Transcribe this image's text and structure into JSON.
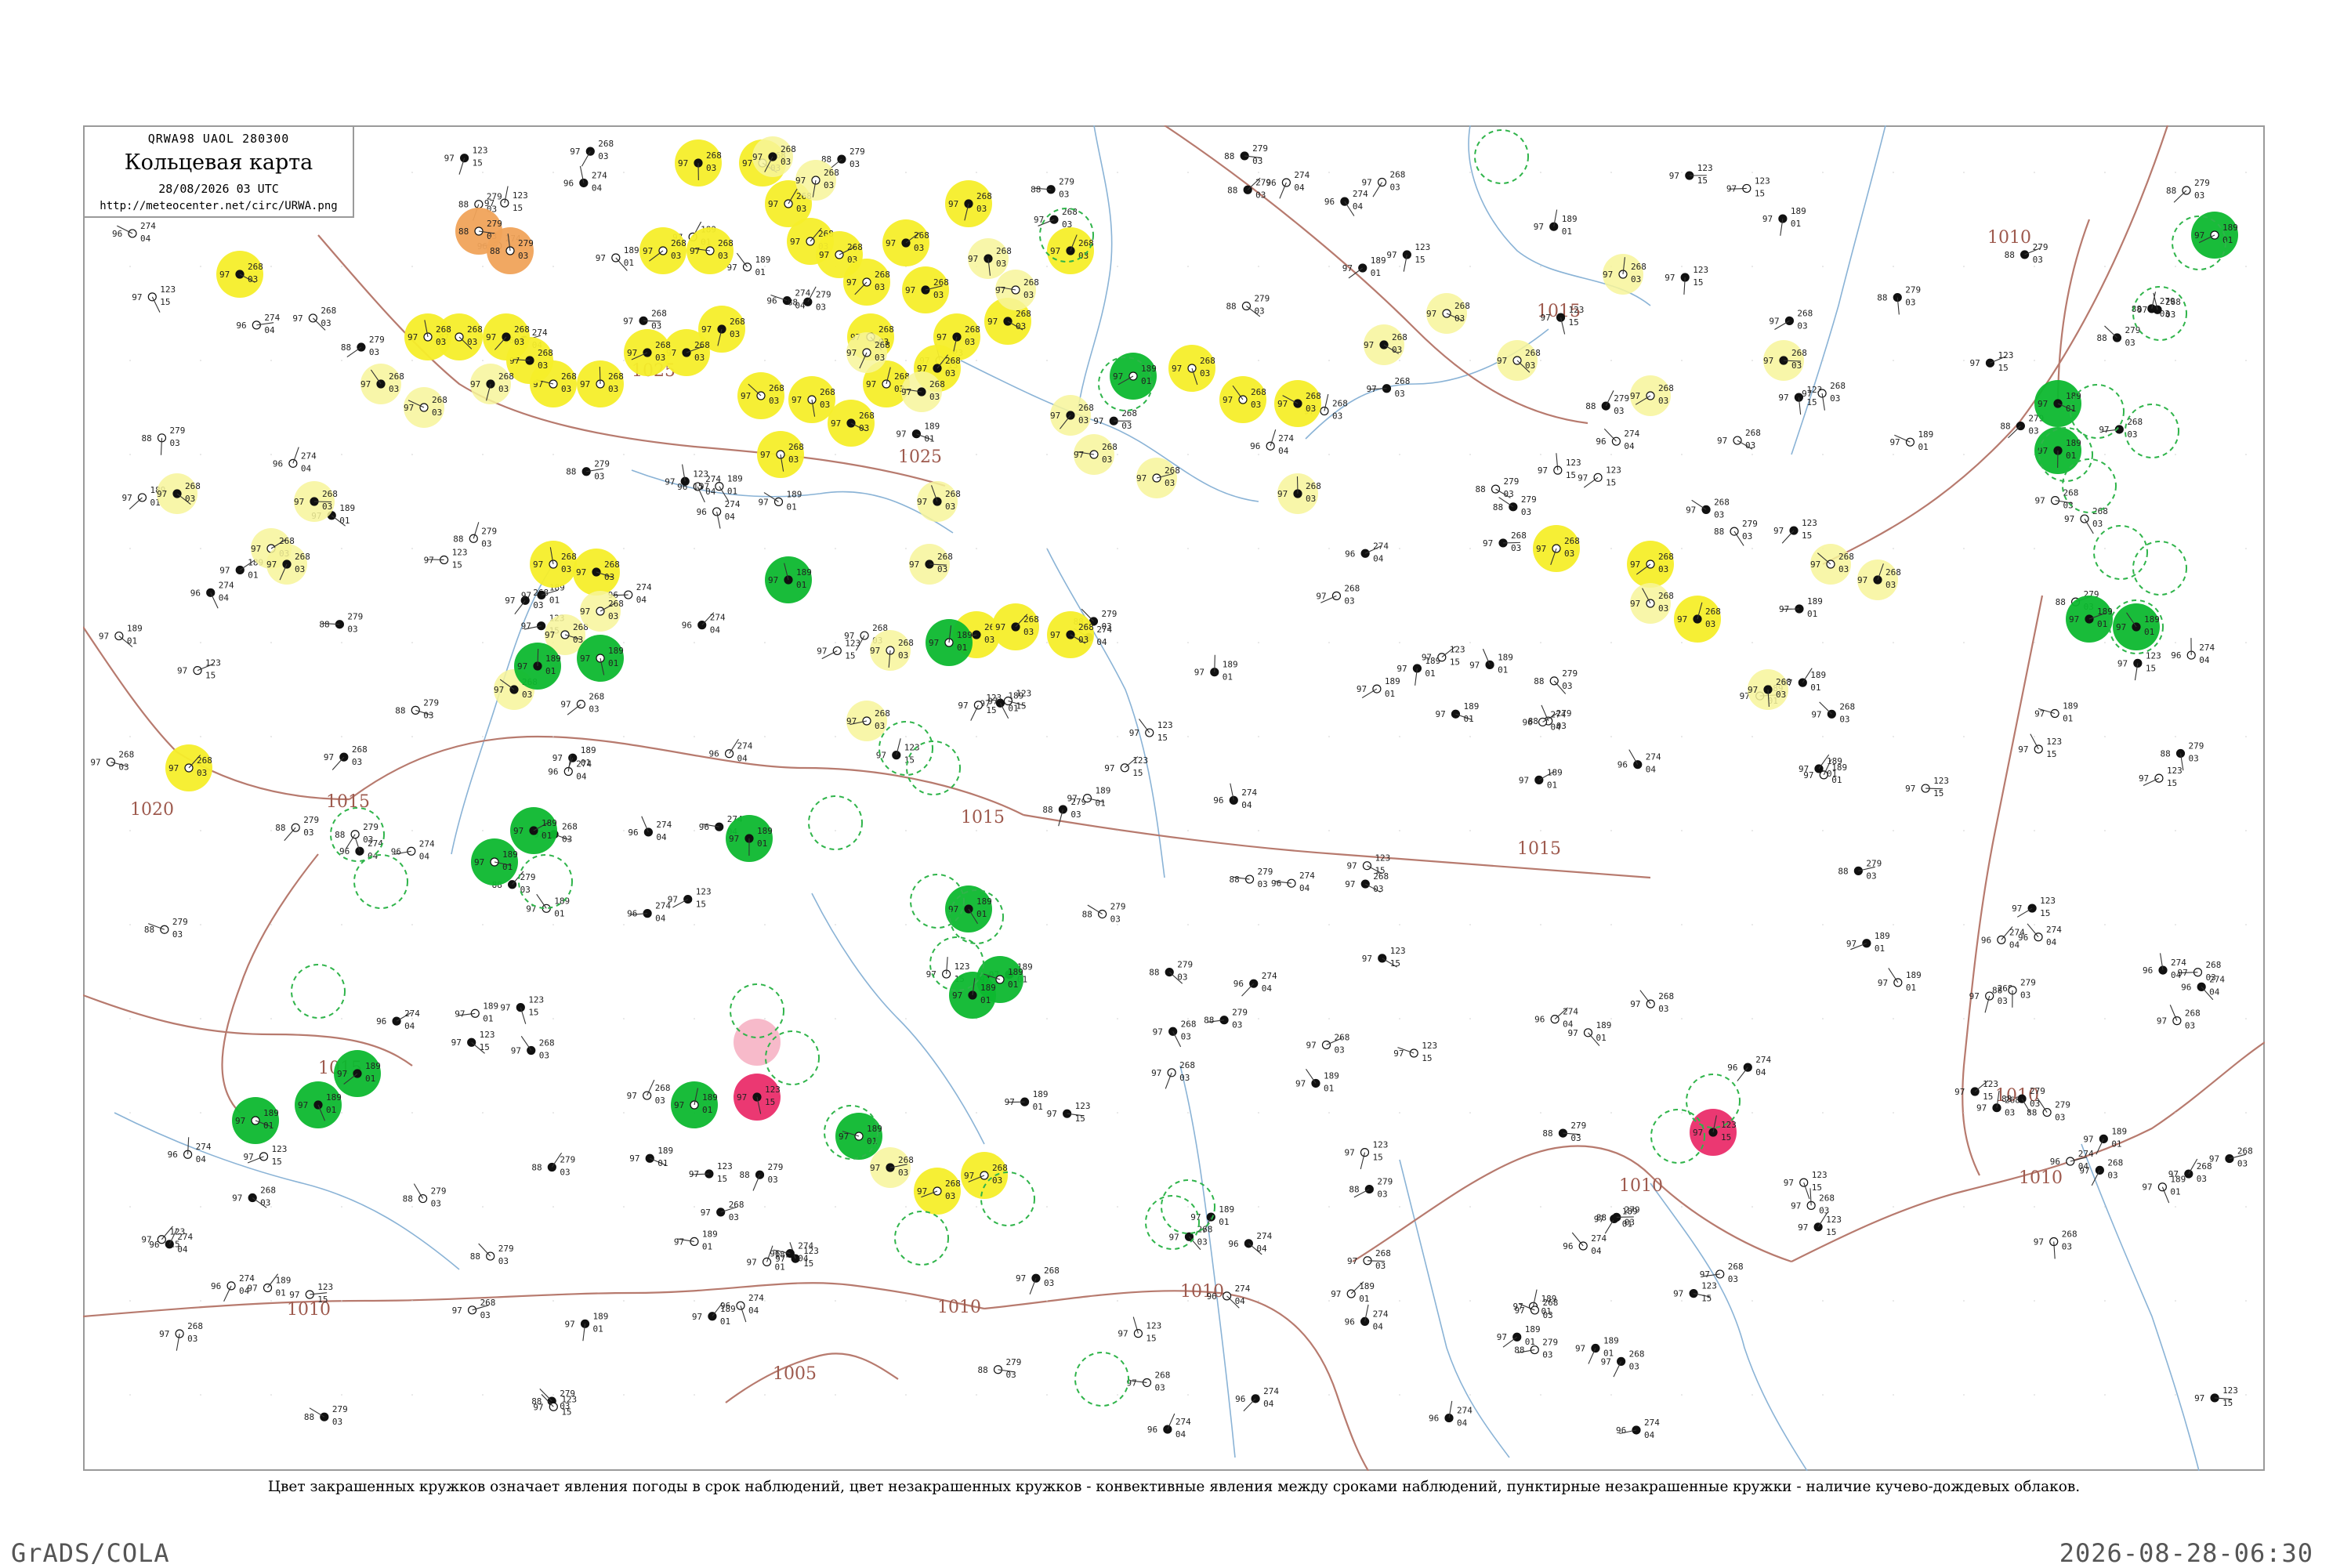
{
  "title_box": {
    "bulletin_code": "QRWA98  UAOL  280300",
    "title": "Кольцевая карта",
    "datetime": "28/08/2026 03 UTC",
    "url": "http://meteocenter.net/circ/URWA.png"
  },
  "caption": "Цвет закрашенных кружков означает явления погоды в срок наблюдений, цвет незакрашенных кружков - конвективные явления между сроками наблюдений, пунктирные незакрашенные кружки - наличие кучево-дождевых облаков.",
  "footer": {
    "left": "GrADS/COLA",
    "right": "2026-08-28-06:30"
  },
  "colors": {
    "isobar": "#b77a6e",
    "river": "#8ab3d6",
    "yellow": "#f5ee2a",
    "light_yellow": "#f7f59a",
    "green": "#0db82f",
    "orange": "#f0a35a",
    "red": "#ea2d6a",
    "pink": "#f6b3c4",
    "dashed_green": "#2fb44a"
  },
  "isobar_labels": [
    {
      "text": "1015"
    },
    {
      "text": "1025"
    },
    {
      "text": "1025"
    },
    {
      "text": "1020"
    },
    {
      "text": "1010"
    },
    {
      "text": "1015"
    },
    {
      "text": "1015"
    },
    {
      "text": "1015"
    },
    {
      "text": "1015"
    },
    {
      "text": "1010"
    },
    {
      "text": "1010"
    },
    {
      "text": "1010"
    },
    {
      "text": "1005"
    },
    {
      "text": "1010"
    },
    {
      "text": "1010"
    },
    {
      "text": "1010"
    }
  ],
  "station_groups": [
    {
      "kind": "yellow",
      "p": "268",
      "t": "97",
      "d": "03"
    },
    {
      "kind": "yellow",
      "p": "274",
      "t": "96",
      "d": "04"
    },
    {
      "kind": "green",
      "p": "189",
      "t": "97",
      "d": "01"
    },
    {
      "kind": "red",
      "p": "123",
      "t": "97",
      "d": "15"
    },
    {
      "kind": "orange",
      "p": "279",
      "t": "88",
      "d": "03"
    }
  ]
}
